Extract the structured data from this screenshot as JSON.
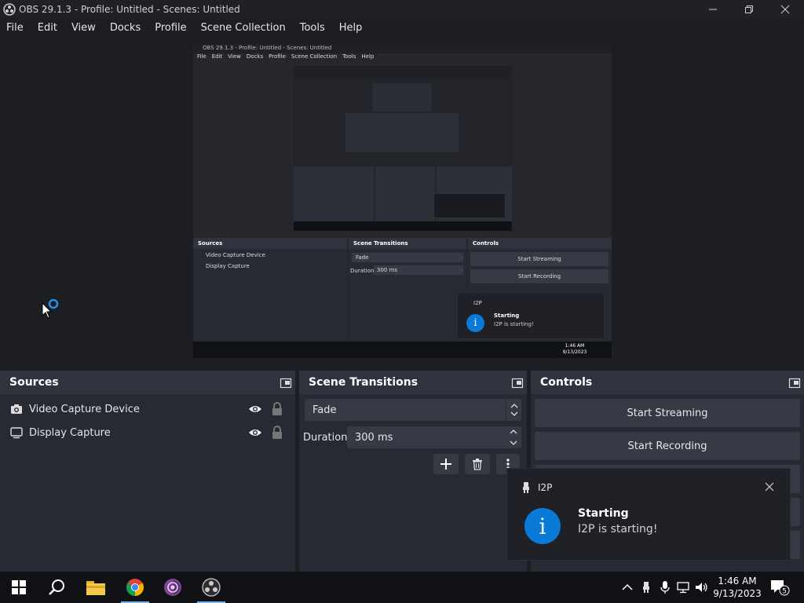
{
  "window": {
    "title": "OBS 29.1.3 - Profile: Untitled - Scenes: Untitled"
  },
  "menu": [
    "File",
    "Edit",
    "View",
    "Docks",
    "Profile",
    "Scene Collection",
    "Tools",
    "Help"
  ],
  "docks": {
    "sources": {
      "title": "Sources",
      "items": [
        {
          "label": "Video Capture Device",
          "icon": "camera-icon"
        },
        {
          "label": "Display Capture",
          "icon": "monitor-icon"
        }
      ]
    },
    "transitions": {
      "title": "Scene Transitions",
      "transition": "Fade",
      "duration_label": "Duration",
      "duration_value": "300 ms"
    },
    "controls": {
      "title": "Controls",
      "buttons": [
        "Start Streaming",
        "Start Recording"
      ]
    }
  },
  "notification": {
    "app": "I2P",
    "title": "Starting",
    "body": "I2P is starting!"
  },
  "taskbar": {
    "apps": [
      "windows-start-icon",
      "search-icon",
      "file-explorer-icon",
      "chrome-icon",
      "tor-browser-icon",
      "obs-icon"
    ],
    "time": "1:46 AM",
    "date": "9/13/2023",
    "notification_count": "5"
  },
  "colors": {
    "accent": "#0a7ad9",
    "dock_bg": "#272a33",
    "dock_header": "#30333d",
    "button_bg": "#373a44"
  },
  "preview_mirror": {
    "menu": [
      "File",
      "Edit",
      "View",
      "Docks",
      "Profile",
      "Scene Collection",
      "Tools",
      "Help"
    ],
    "title": "OBS 29.1.3 - Profile: Untitled - Scenes: Untitled",
    "sources_title": "Sources",
    "sources": [
      "Video Capture Device",
      "Display Capture"
    ],
    "transitions_title": "Scene Transitions",
    "transition": "Fade",
    "duration_label": "Duration",
    "duration_value": "300 ms",
    "controls_title": "Controls",
    "buttons": [
      "Start Streaming",
      "Start Recording"
    ],
    "notif_app": "I2P",
    "notif_title": "Starting",
    "notif_body": "I2P is starting!",
    "time": "1:46 AM",
    "date": "9/13/2023"
  }
}
